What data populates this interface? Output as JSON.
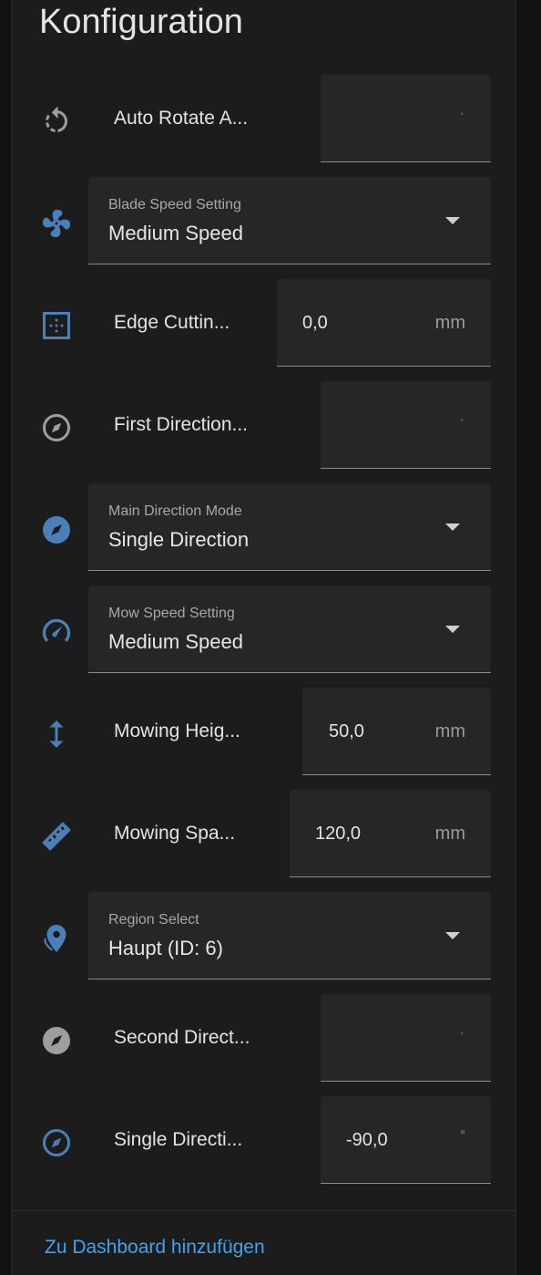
{
  "card": {
    "title": "Konfiguration",
    "footer_link": "Zu Dashboard hinzufügen"
  },
  "colors": {
    "accent": "#4a7fb8",
    "gray_icon": "#9e9e9e",
    "link": "#3ea3f0"
  },
  "rows": [
    {
      "type": "number",
      "icon": "rotate-icon",
      "label": "Auto Rotate A...",
      "value": "",
      "unit": "•"
    },
    {
      "type": "select",
      "icon": "fan-icon",
      "label": "Blade Speed Setting",
      "value": "Medium Speed"
    },
    {
      "type": "number",
      "icon": "edge-cutting-icon",
      "label": "Edge Cuttin...",
      "value": "0,0",
      "unit": "mm"
    },
    {
      "type": "number",
      "icon": "compass-outline-icon",
      "label": "First Direction...",
      "value": "",
      "unit": "•"
    },
    {
      "type": "select",
      "icon": "compass-icon",
      "label": "Main Direction Mode",
      "value": "Single Direction"
    },
    {
      "type": "select",
      "icon": "speedometer-icon",
      "label": "Mow Speed Setting",
      "value": "Medium Speed"
    },
    {
      "type": "number",
      "icon": "arrow-up-down-icon",
      "label": "Mowing Heig...",
      "value": "50,0",
      "unit": "mm"
    },
    {
      "type": "number",
      "icon": "ruler-icon",
      "label": "Mowing Spa...",
      "value": "120,0",
      "unit": "mm"
    },
    {
      "type": "select",
      "icon": "map-marker-icon",
      "label": "Region Select",
      "value": "Haupt (ID: 6)"
    },
    {
      "type": "number",
      "icon": "compass-icon-gray",
      "label": "Second Direct...",
      "value": "",
      "unit": "•"
    },
    {
      "type": "number",
      "icon": "compass-outline-icon",
      "label": "Single Directi...",
      "value": "-90,0",
      "unit": "°"
    }
  ]
}
